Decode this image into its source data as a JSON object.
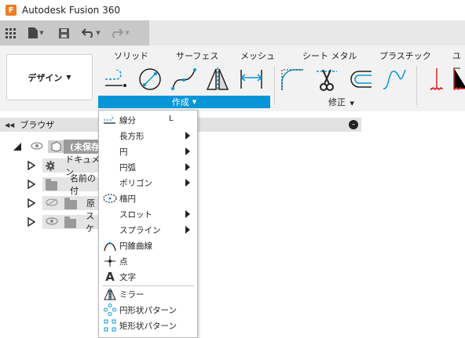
{
  "window": {
    "title": "Autodesk Fusion 360",
    "logo_letter": "F"
  },
  "workspace": {
    "label": "デザイン"
  },
  "ribbon": {
    "tabs": [
      {
        "id": "solid",
        "label": "ソリッド"
      },
      {
        "id": "surface",
        "label": "サーフェス"
      },
      {
        "id": "mesh",
        "label": "メッシュ"
      },
      {
        "id": "sheetmetal",
        "label": "シート メタル"
      },
      {
        "id": "plastic",
        "label": "プラスチック"
      },
      {
        "id": "utility",
        "label": "ユー"
      }
    ],
    "groups": {
      "create": "作成",
      "modify": "修正"
    }
  },
  "browser": {
    "title": "ブラウザ"
  },
  "tree": {
    "root": "(未保存",
    "items": [
      {
        "label": "ドキュメン",
        "icon": "gear-icon"
      },
      {
        "label": "名前の付",
        "icon": "folder-icon"
      },
      {
        "label": "原",
        "icon": "folder-icon"
      },
      {
        "label": "スケ",
        "icon": "folder-icon"
      }
    ]
  },
  "create_menu": {
    "items": [
      {
        "label": "線分",
        "shortcut": "L",
        "icon": "line-icon",
        "submenu": false
      },
      {
        "label": "長方形",
        "icon": "",
        "submenu": true
      },
      {
        "label": "円",
        "icon": "",
        "submenu": true
      },
      {
        "label": "円弧",
        "icon": "",
        "submenu": true
      },
      {
        "label": "ポリゴン",
        "icon": "",
        "submenu": true
      },
      {
        "label": "楕円",
        "icon": "ellipse-icon",
        "submenu": false
      },
      {
        "label": "スロット",
        "icon": "",
        "submenu": true
      },
      {
        "label": "スプライン",
        "icon": "",
        "submenu": true
      },
      {
        "label": "円錐曲線",
        "icon": "conic-curve-icon",
        "submenu": false
      },
      {
        "label": "点",
        "icon": "point-icon",
        "submenu": false
      },
      {
        "label": "文字",
        "icon": "text-icon",
        "submenu": false
      },
      {
        "label": "ミラー",
        "icon": "mirror-icon",
        "submenu": false
      },
      {
        "label": "円形状パターン",
        "icon": "circular-pattern-icon",
        "submenu": false
      },
      {
        "label": "矩形状パターン",
        "icon": "rectangular-pattern-icon",
        "submenu": false
      }
    ]
  },
  "colors": {
    "accent": "#0696d7",
    "ribbon_bg": "#f2f2f2",
    "qat_bg": "#c8c8c8",
    "icon_blue": "#0696d7",
    "icon_red": "#d22"
  }
}
